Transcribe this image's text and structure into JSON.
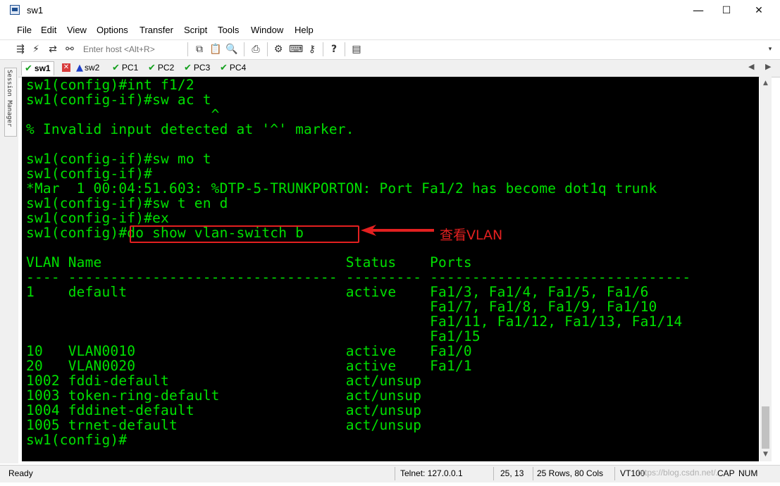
{
  "window": {
    "title": "sw1",
    "min": "—",
    "max": "☐",
    "close": "✕"
  },
  "menu": [
    "File",
    "Edit",
    "View",
    "Options",
    "Transfer",
    "Script",
    "Tools",
    "Window",
    "Help"
  ],
  "toolbar": {
    "host_placeholder": "Enter host <Alt+R>"
  },
  "tabs": [
    {
      "label": "sw1",
      "status": "connected",
      "active": true
    },
    {
      "label": "sw2",
      "status": "warning",
      "active": false
    },
    {
      "label": "PC1",
      "status": "connected",
      "active": false
    },
    {
      "label": "PC2",
      "status": "connected",
      "active": false
    },
    {
      "label": "PC3",
      "status": "connected",
      "active": false
    },
    {
      "label": "PC4",
      "status": "connected",
      "active": false
    }
  ],
  "session_manager_label": "Session Manager",
  "terminal": {
    "lines": [
      "sw1(config)#int f1/2",
      "sw1(config-if)#sw ac t",
      "                      ^",
      "% Invalid input detected at '^' marker.",
      "",
      "sw1(config-if)#sw mo t",
      "sw1(config-if)#",
      "*Mar  1 00:04:51.603: %DTP-5-TRUNKPORTON: Port Fa1/2 has become dot1q trunk",
      "sw1(config-if)#sw t en d",
      "sw1(config-if)#ex",
      "sw1(config)#do show vlan-switch b",
      "",
      "VLAN Name                             Status    Ports",
      "---- -------------------------------- --------- -------------------------------",
      "1    default                          active    Fa1/3, Fa1/4, Fa1/5, Fa1/6",
      "                                                Fa1/7, Fa1/8, Fa1/9, Fa1/10",
      "                                                Fa1/11, Fa1/12, Fa1/13, Fa1/14",
      "                                                Fa1/15",
      "10   VLAN0010                         active    Fa1/0",
      "20   VLAN0020                         active    Fa1/1",
      "1002 fddi-default                     act/unsup",
      "1003 token-ring-default               act/unsup",
      "1004 fddinet-default                  act/unsup",
      "1005 trnet-default                    act/unsup",
      "sw1(config)#"
    ],
    "annotation": "查看VLAN"
  },
  "status": {
    "ready": "Ready",
    "connection": "Telnet: 127.0.0.1",
    "cursor": "25,  13",
    "size": "25 Rows, 80 Cols",
    "terminal_type": "VT100",
    "caps": "CAP",
    "num": "NUM",
    "watermark": "https://blog.csdn.net/..."
  },
  "colors": {
    "terminal_bg": "#000000",
    "terminal_fg": "#00e000",
    "annotation": "#e32020",
    "tab_ok": "#14a01e"
  }
}
